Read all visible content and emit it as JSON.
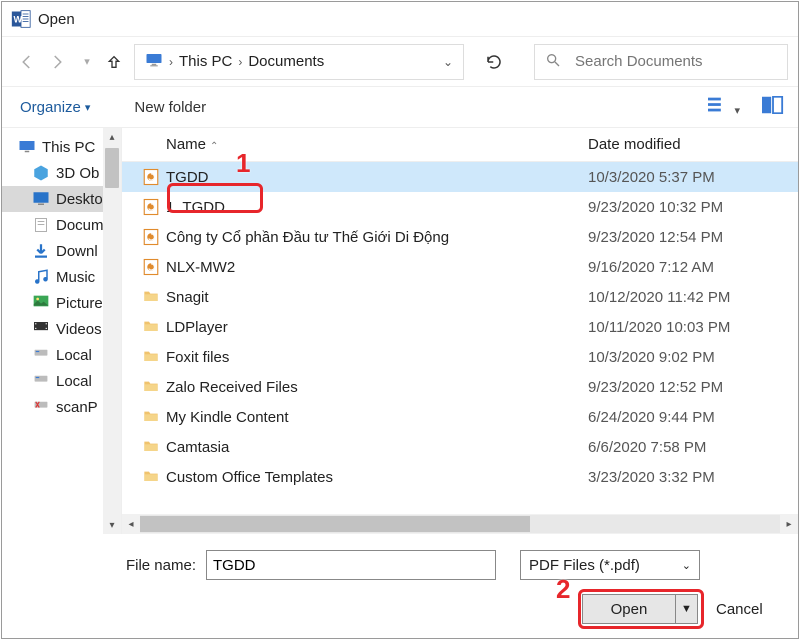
{
  "window": {
    "title": "Open"
  },
  "breadcrumb": {
    "root": "This PC",
    "folder": "Documents"
  },
  "search": {
    "placeholder": "Search Documents"
  },
  "toolbar": {
    "organize": "Organize",
    "new_folder": "New folder"
  },
  "sidebar": {
    "items": [
      {
        "label": "This PC",
        "icon": "monitor"
      },
      {
        "label": "3D Ob",
        "icon": "cube",
        "indent": true
      },
      {
        "label": "Deskto",
        "icon": "desktop",
        "indent": true,
        "selected": true
      },
      {
        "label": "Docum",
        "icon": "doc",
        "indent": true
      },
      {
        "label": "Downl",
        "icon": "download",
        "indent": true
      },
      {
        "label": "Music",
        "icon": "music",
        "indent": true
      },
      {
        "label": "Picture",
        "icon": "picture",
        "indent": true
      },
      {
        "label": "Videos",
        "icon": "video",
        "indent": true
      },
      {
        "label": "Local",
        "icon": "drive",
        "indent": true
      },
      {
        "label": "Local",
        "icon": "drive",
        "indent": true
      },
      {
        "label": "scanP",
        "icon": "drive-x",
        "indent": true
      }
    ]
  },
  "columns": {
    "name": "Name",
    "date": "Date modified"
  },
  "files": [
    {
      "name": "TGDD",
      "date": "10/3/2020 5:37 PM",
      "type": "pdf",
      "selected": true
    },
    {
      "name": "1. TGDD",
      "date": "9/23/2020 10:32 PM",
      "type": "pdf"
    },
    {
      "name": "Công ty Cổ phần Đầu tư Thế Giới Di Động",
      "date": "9/23/2020 12:54 PM",
      "type": "pdf"
    },
    {
      "name": "NLX-MW2",
      "date": "9/16/2020 7:12 AM",
      "type": "pdf"
    },
    {
      "name": "Snagit",
      "date": "10/12/2020 11:42 PM",
      "type": "folder"
    },
    {
      "name": "LDPlayer",
      "date": "10/11/2020 10:03 PM",
      "type": "folder"
    },
    {
      "name": "Foxit files",
      "date": "10/3/2020 9:02 PM",
      "type": "folder"
    },
    {
      "name": "Zalo Received Files",
      "date": "9/23/2020 12:52 PM",
      "type": "folder"
    },
    {
      "name": "My Kindle Content",
      "date": "6/24/2020 9:44 PM",
      "type": "folder"
    },
    {
      "name": "Camtasia",
      "date": "6/6/2020 7:58 PM",
      "type": "folder"
    },
    {
      "name": "Custom Office Templates",
      "date": "3/23/2020 3:32 PM",
      "type": "folder"
    }
  ],
  "footer": {
    "filename_label": "File name:",
    "filename_value": "TGDD",
    "filetype": "PDF Files (*.pdf)",
    "open": "Open",
    "cancel": "Cancel"
  },
  "annotations": {
    "n1": "1",
    "n2": "2"
  }
}
